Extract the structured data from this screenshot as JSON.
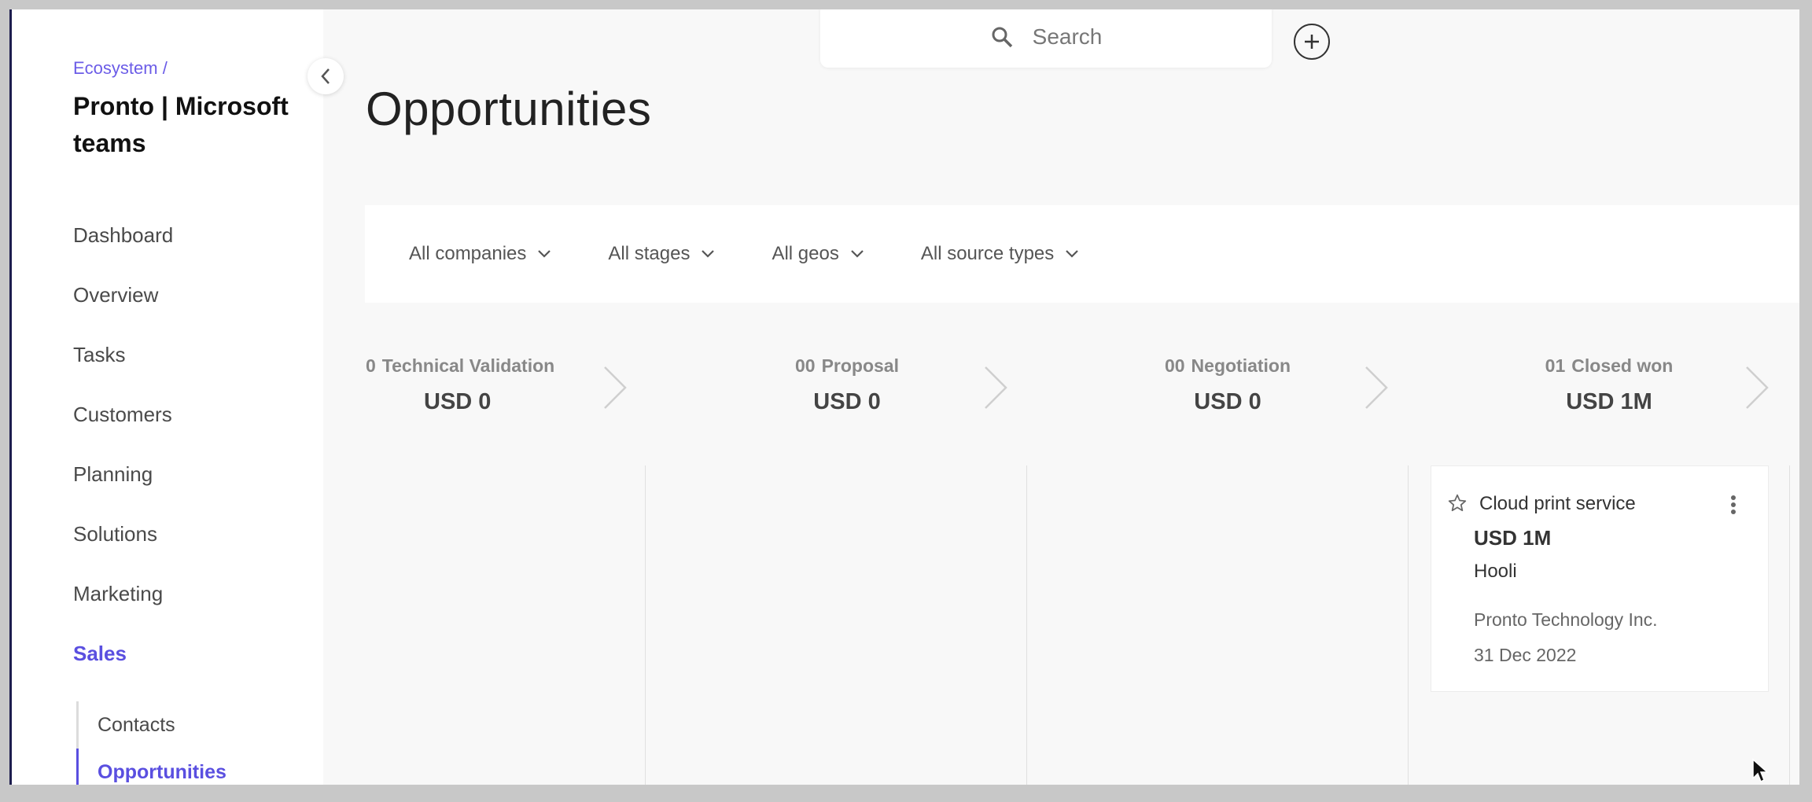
{
  "sidebar": {
    "breadcrumb": "Ecosystem /",
    "title": "Pronto | Microsoft teams",
    "items": [
      {
        "label": "Dashboard"
      },
      {
        "label": "Overview"
      },
      {
        "label": "Tasks"
      },
      {
        "label": "Customers"
      },
      {
        "label": "Planning"
      },
      {
        "label": "Solutions"
      },
      {
        "label": "Marketing"
      },
      {
        "label": "Sales",
        "active": true
      }
    ],
    "subitems": [
      {
        "label": "Contacts"
      },
      {
        "label": "Opportunities",
        "active": true
      }
    ]
  },
  "search": {
    "placeholder": "Search"
  },
  "page": {
    "title": "Opportunities"
  },
  "filters": [
    {
      "label": "All companies"
    },
    {
      "label": "All stages"
    },
    {
      "label": "All geos"
    },
    {
      "label": "All source types"
    }
  ],
  "stages": [
    {
      "count": "0",
      "name": "Technical Validation",
      "amount": "USD 0"
    },
    {
      "count": "00",
      "name": "Proposal",
      "amount": "USD 0"
    },
    {
      "count": "00",
      "name": "Negotiation",
      "amount": "USD 0"
    },
    {
      "count": "01",
      "name": "Closed won",
      "amount": "USD 1M"
    }
  ],
  "card": {
    "name": "Cloud print service",
    "amount": "USD 1M",
    "company": "Hooli",
    "organization": "Pronto Technology Inc.",
    "date": "31 Dec 2022"
  },
  "colors": {
    "accent": "#5a4fe0",
    "background": "#f8f8f8"
  }
}
